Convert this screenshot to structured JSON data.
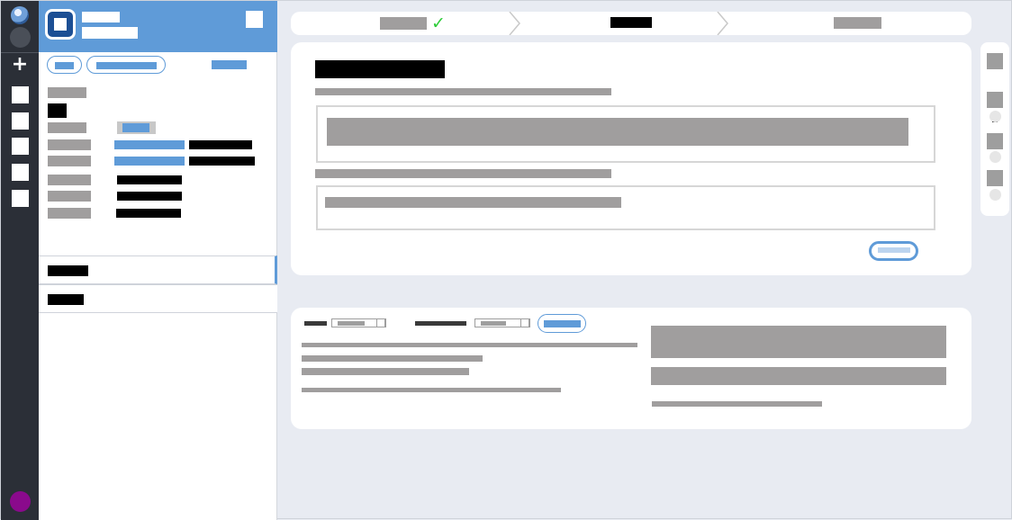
{
  "app": {
    "name": "",
    "subtitle": "",
    "redaction_note": ""
  },
  "rail": {
    "icons": [
      "globe-icon",
      "circle-icon",
      "plus-icon",
      "nav-square-icon",
      "nav-square-icon",
      "nav-square-icon",
      "nav-square-icon",
      "nav-square-icon",
      "avatar"
    ]
  },
  "sidebar": {
    "filters": [
      "",
      ""
    ],
    "link": "",
    "fields": [
      {
        "label": "",
        "value": ""
      },
      {
        "label": "",
        "value": ""
      },
      {
        "label": "",
        "value": ""
      },
      {
        "label": "",
        "value": ""
      },
      {
        "label": "",
        "value": ""
      },
      {
        "label": "",
        "value": ""
      },
      {
        "label": "",
        "value": ""
      },
      {
        "label": "",
        "value": ""
      }
    ],
    "tabs": [
      "",
      ""
    ]
  },
  "stepper": {
    "steps": [
      {
        "label": "",
        "state": "complete"
      },
      {
        "label": "",
        "state": "current"
      },
      {
        "label": "",
        "state": "upcoming"
      }
    ]
  },
  "form": {
    "title": "",
    "field1_label": "",
    "field1_value": "",
    "field2_label": "",
    "field2_value": "",
    "submit": ""
  },
  "mininav": {
    "count": "2"
  },
  "bottom": {
    "control1_label": "",
    "control2_label": "",
    "button": ""
  },
  "colors": {
    "accent": "#5f9bd8",
    "rail": "#2b2f37",
    "check": "#2ecc3a",
    "avatar": "#8a0a8c",
    "placeholder_gray": "#a09e9e"
  }
}
